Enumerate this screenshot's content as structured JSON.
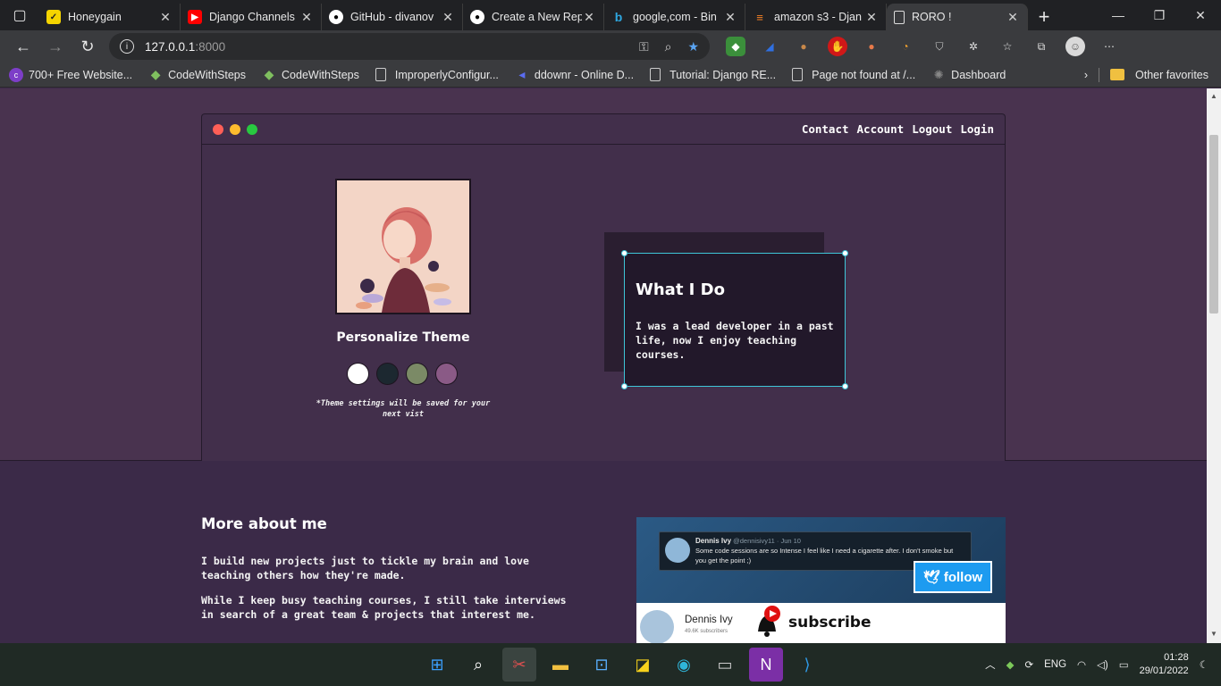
{
  "browser": {
    "tabs": [
      {
        "title": "Honeygain",
        "icon": "honeygain-icon"
      },
      {
        "title": "Django Channels",
        "icon": "youtube-icon"
      },
      {
        "title": "GitHub - divanov",
        "icon": "github-icon"
      },
      {
        "title": "Create a New Rep",
        "icon": "github-icon"
      },
      {
        "title": "google,com - Bin",
        "icon": "bing-icon"
      },
      {
        "title": "amazon s3 - Djan",
        "icon": "stackoverflow-icon"
      },
      {
        "title": "RORO !",
        "icon": "page-icon"
      }
    ],
    "address_host": "127.0.0.1",
    "address_port": ":8000",
    "bookmarks": [
      {
        "label": "700+ Free Website..."
      },
      {
        "label": "CodeWithSteps"
      },
      {
        "label": "CodeWithSteps"
      },
      {
        "label": "ImproperlyConfigur..."
      },
      {
        "label": "ddownr - Online D..."
      },
      {
        "label": "Tutorial: Django RE..."
      },
      {
        "label": "Page not found at /..."
      },
      {
        "label": "Dashboard"
      }
    ],
    "other_favorites": "Other favorites"
  },
  "site": {
    "nav": [
      "Contact",
      "Account",
      "Logout",
      "Login"
    ],
    "theme_title": "Personalize Theme",
    "theme_note": "*Theme settings will be saved for your next vist",
    "swatch_colors": [
      "#ffffff",
      "#1c2830",
      "#7b8a66",
      "#8a5a86"
    ],
    "what_title": "What I Do",
    "what_text": "I was a lead developer in a past life, now I enjoy teaching courses.",
    "more_title": "More about me",
    "more_p1": "I build new projects just to tickle my brain and love teaching others how they're made.",
    "more_p2": "While I keep busy teaching courses, I still take interviews in search of a great team & projects that interest me."
  },
  "social": {
    "tweet_name": "Dennis Ivy",
    "tweet_handle": "@dennisivy11 · Jun 10",
    "tweet_text": "Some code sessions are so Intense I feel like I need a cigarette after. I don't smoke but you get the point ;)",
    "follow": "follow",
    "yt_name": "Dennis Ivy",
    "yt_subs": "49.6K subscribers",
    "subscribe": "subscribe"
  },
  "taskbar": {
    "lang": "ENG",
    "time": "01:28",
    "date": "29/01/2022"
  }
}
